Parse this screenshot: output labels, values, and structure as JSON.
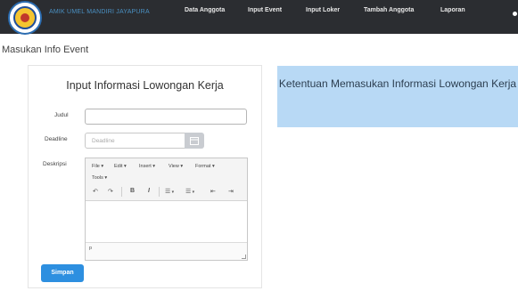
{
  "navbar": {
    "brand": "AMIK UMEL MANDIRI JAYAPURA",
    "items": [
      {
        "label": "Data Anggota"
      },
      {
        "label": "Input Event"
      },
      {
        "label": "Input Loker"
      },
      {
        "label": "Tambah Anggota"
      },
      {
        "label": "Laporan"
      }
    ]
  },
  "page": {
    "title": "Masukan Info Event"
  },
  "form": {
    "title": "Input Informasi Lowongan Kerja",
    "judul_label": "Judul",
    "judul_value": "",
    "deadline_label": "Deadline",
    "deadline_placeholder": "Deadline",
    "deskripsi_label": "Deskripsi",
    "editor": {
      "menu": [
        "File",
        "Edit",
        "Insert",
        "View",
        "Format",
        "Tools"
      ],
      "toolbar": {
        "undo": "↶",
        "redo": "↷",
        "bold": "B",
        "italic": "I",
        "bullet_list": "☰",
        "numbered_list": "☰",
        "outdent": "⇤",
        "indent": "⇥"
      },
      "status_path": "p"
    },
    "submit_label": "Simpan"
  },
  "rules": {
    "title": "Ketentuan Memasukan Informasi Lowongan Kerja"
  },
  "colors": {
    "navbar": "#2b2d31",
    "primary": "#2d8fe0",
    "info_panel": "#b8d9f5"
  }
}
